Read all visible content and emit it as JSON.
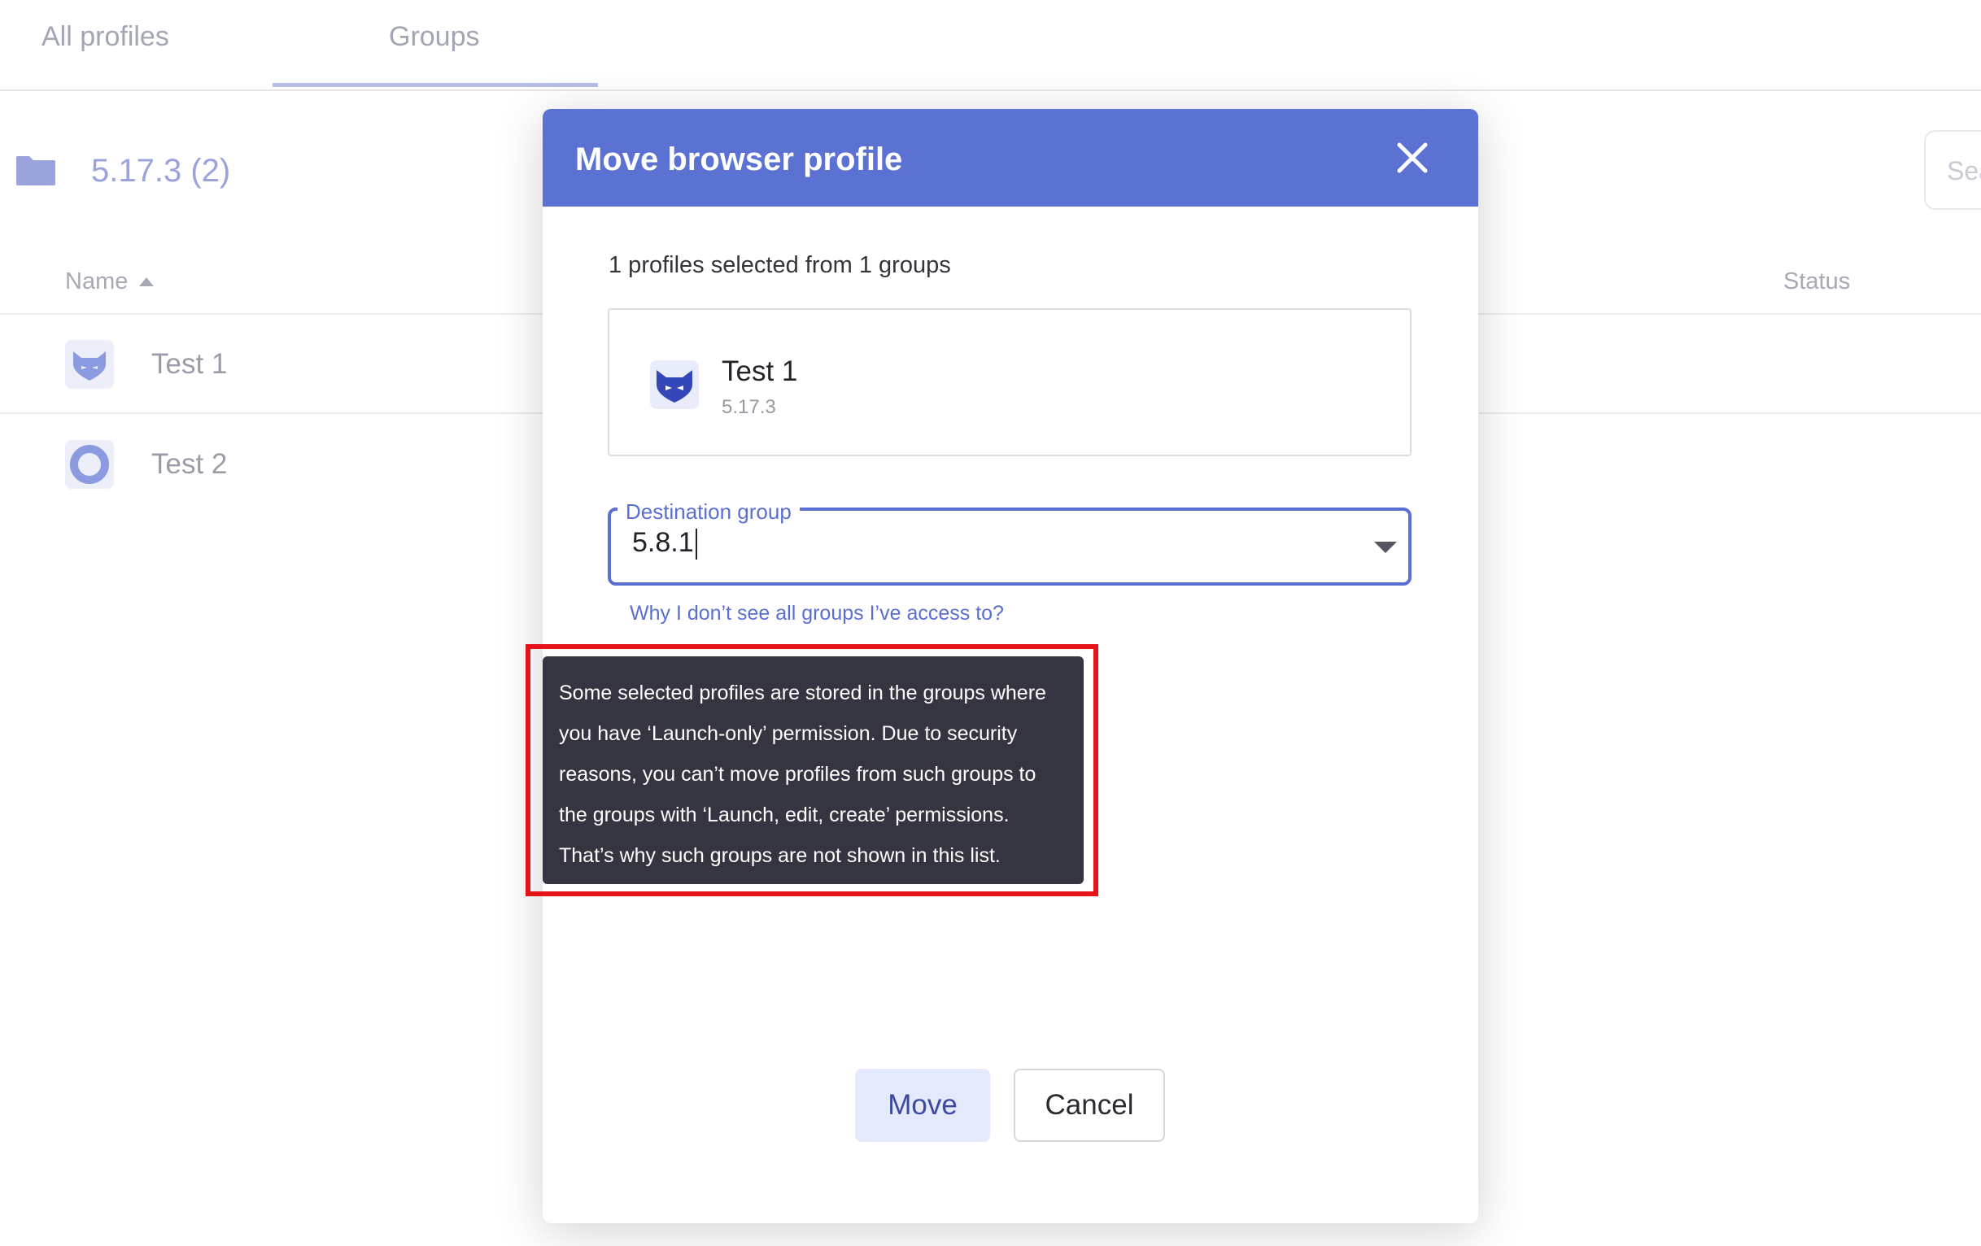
{
  "tabs": [
    {
      "label": "All profiles"
    },
    {
      "label": "Groups",
      "active": true
    }
  ],
  "group": {
    "title": "5.17.3 (2)",
    "icon": "folder-icon"
  },
  "search": {
    "placeholder": "Sea"
  },
  "table": {
    "columns": [
      {
        "label": "Name",
        "sorted": "ascending"
      },
      {
        "label": "Status"
      }
    ],
    "rows": [
      {
        "label": "Test 1",
        "icon": "fox-browser-icon"
      },
      {
        "label": "Test 2",
        "icon": "ring-browser-icon"
      }
    ]
  },
  "modal": {
    "title": "Move browser profile",
    "selected_info": "1 profiles selected from 1 groups",
    "profile": {
      "name": "Test 1",
      "version": "5.17.3",
      "icon": "fox-browser-icon"
    },
    "destination": {
      "label": "Destination group",
      "value": "5.8.1"
    },
    "help_link": "Why I don’t see all groups I’ve access to?",
    "tooltip": "Some selected profiles are stored in the groups where you have ‘Launch-only’ permission. Due to security reasons, you can’t move profiles from such groups to the groups with ‘Launch, edit, create’ permissions. That’s why such groups are not shown in this list.",
    "buttons": {
      "move": "Move",
      "cancel": "Cancel"
    }
  },
  "colors": {
    "accent": "#5b72d2",
    "tooltip_bg": "#343541",
    "highlight": "#e5141b"
  }
}
